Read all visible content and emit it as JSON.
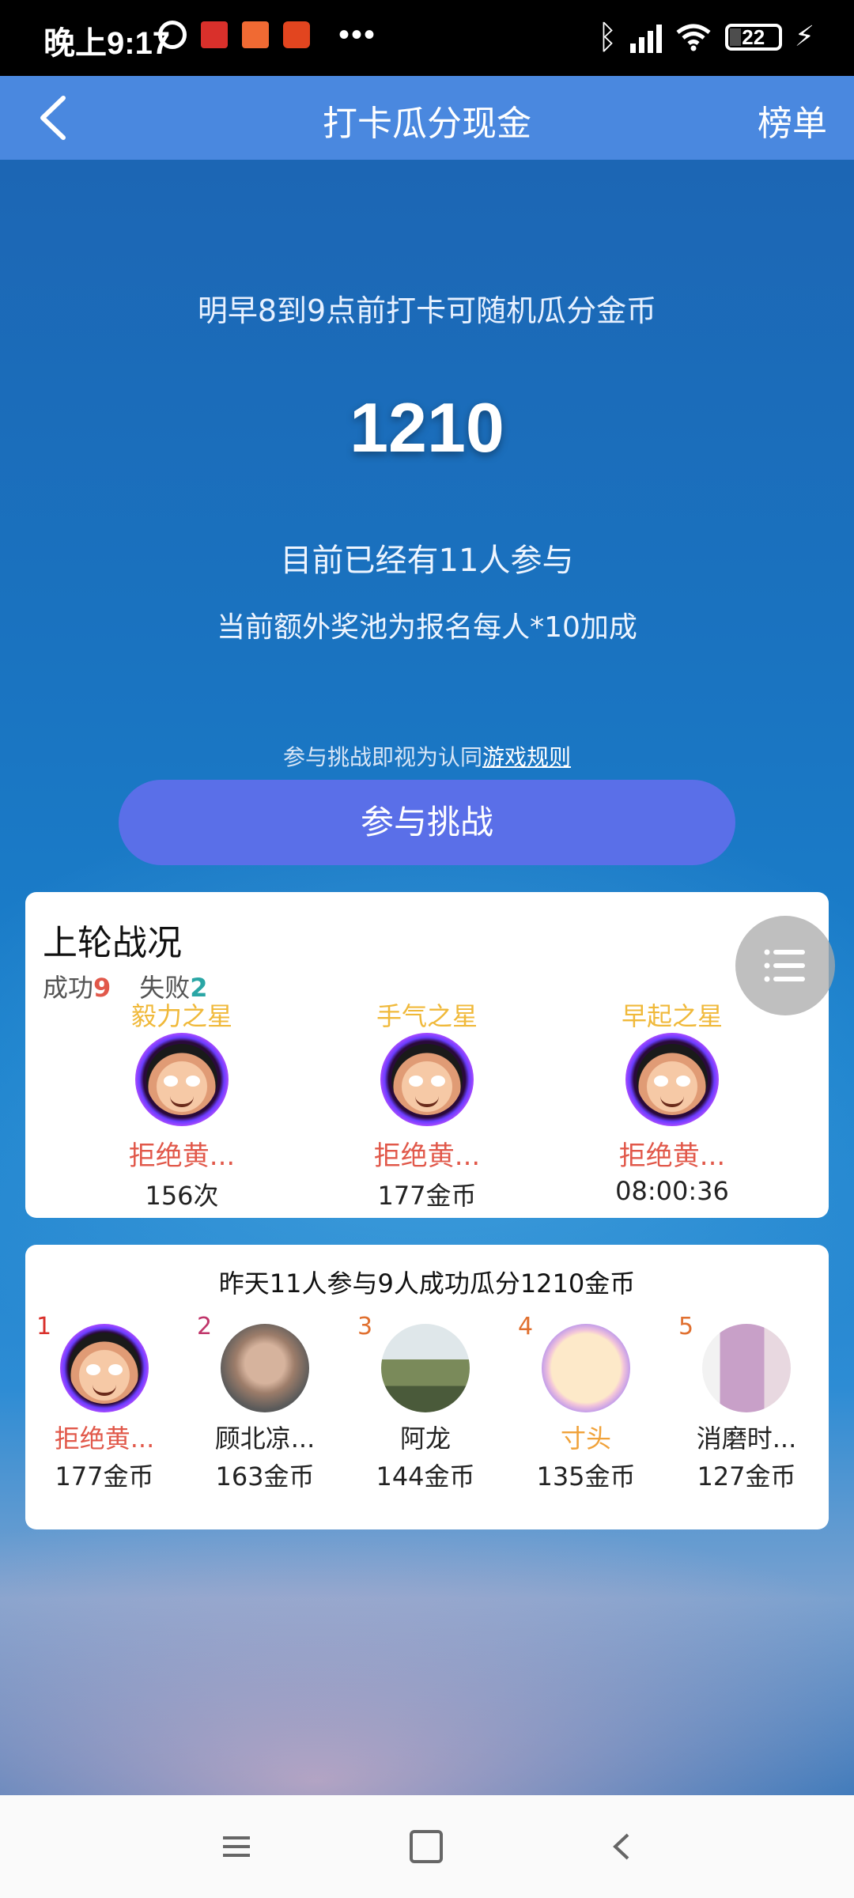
{
  "status_bar": {
    "time": "晚上9:17",
    "battery": "22"
  },
  "header": {
    "title": "打卡瓜分现金",
    "right_label": "榜单"
  },
  "hero": {
    "promo": "明早8到9点前打卡可随机瓜分金币",
    "pool_amount": "1210",
    "participants": "目前已经有11人参与",
    "extra_pool": "当前额外奖池为报名每人*10加成",
    "rules_prefix": "参与挑战即视为认同",
    "rules_link": "游戏规则",
    "join_button": "参与挑战"
  },
  "last_round": {
    "title": "上轮战况",
    "success_label": "成功",
    "success_count": "9",
    "fail_label": "失败",
    "fail_count": "2",
    "stars": [
      {
        "label": "毅力之星",
        "name": "拒绝黄...",
        "value": "156次"
      },
      {
        "label": "手气之星",
        "name": "拒绝黄...",
        "value": "177金币"
      },
      {
        "label": "早起之星",
        "name": "拒绝黄...",
        "value": "08:00:36"
      }
    ]
  },
  "yesterday": {
    "summary": "昨天11人参与9人成功瓜分1210金币",
    "ranks": [
      {
        "rank": "1",
        "name": "拒绝黄...",
        "value": "177金币"
      },
      {
        "rank": "2",
        "name": "顾北凉...",
        "value": "163金币"
      },
      {
        "rank": "3",
        "name": "阿龙",
        "value": "144金币"
      },
      {
        "rank": "4",
        "name": "寸头",
        "value": "135金币"
      },
      {
        "rank": "5",
        "name": "消磨时...",
        "value": "127金币"
      }
    ]
  },
  "colors": {
    "header_bg": "#4a88df",
    "button_bg": "#5a6fe8",
    "success": "#e1584a",
    "fail": "#2aa6a5",
    "star_label": "#f0b93a"
  }
}
